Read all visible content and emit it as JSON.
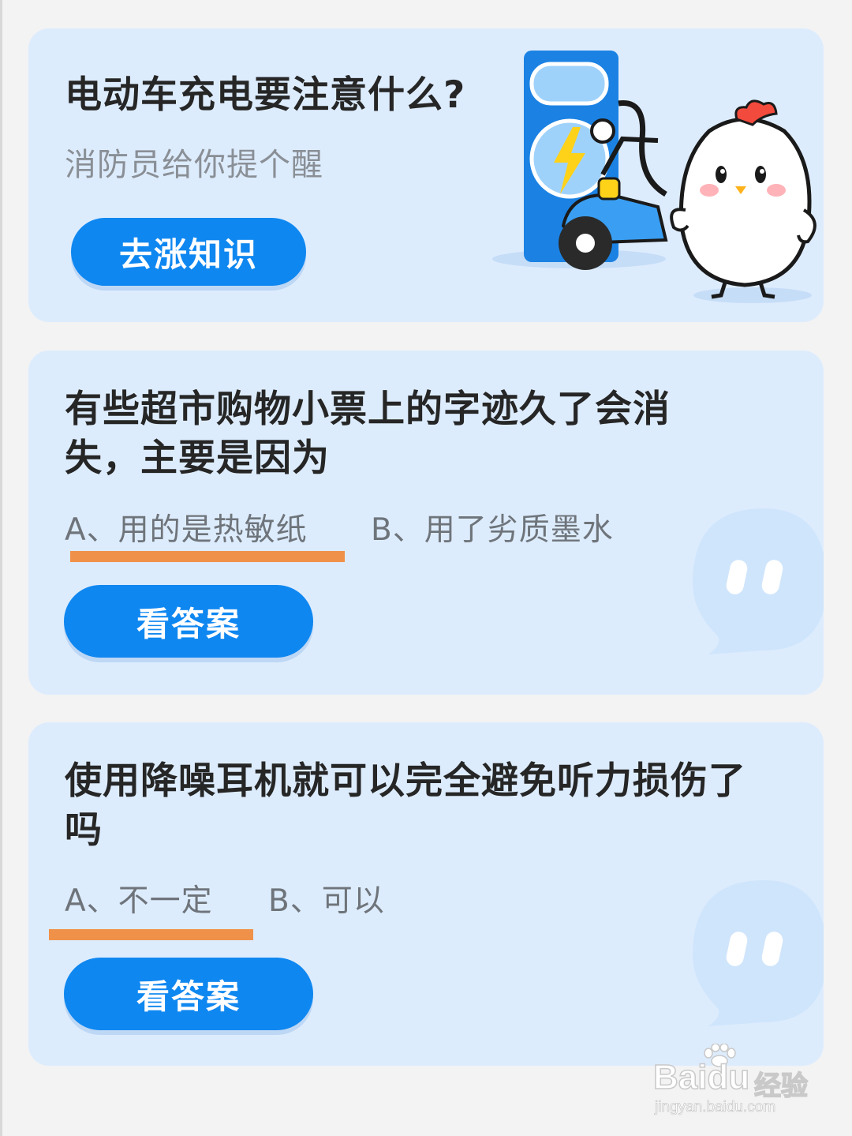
{
  "colors": {
    "card_bg": "#ddecfd",
    "button_bg": "#0f87f0",
    "underline": "#f0914a",
    "title_text": "#262626",
    "option_text": "#6e747a"
  },
  "tip_card": {
    "title": "电动车充电要注意什么?",
    "subtitle": "消防员给你提个醒",
    "button_label": "去涨知识",
    "illustration": "chick-mascot-charging-scooter"
  },
  "quiz1": {
    "question": "有些超市购物小票上的字迹久了会消失，主要是因为",
    "option_a": "A、用的是热敏纸",
    "option_b": "B、用了劣质墨水",
    "underlined_option": "A",
    "button_label": "看答案"
  },
  "quiz2": {
    "question": "使用降噪耳机就可以完全避免听力损伤了吗",
    "option_a": "A、不一定",
    "option_b": "B、可以",
    "underlined_option": "A",
    "button_label": "看答案"
  },
  "watermark": {
    "brand": "Baidu",
    "sub": "经验",
    "url": "jingyan.baidu.com"
  }
}
